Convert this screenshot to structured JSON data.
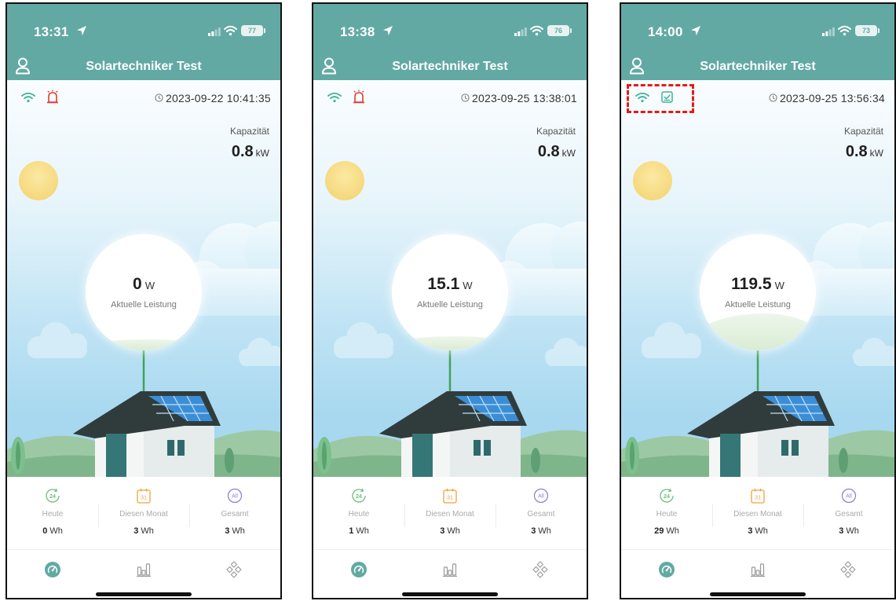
{
  "colors": {
    "accent": "#62a9a4",
    "alarm": "#e53935",
    "highlight": "#e21b1b"
  },
  "phones": [
    {
      "status_time": "13:31",
      "battery": "77",
      "app_title": "Solartechniker Test",
      "timestamp": "2023-09-22 10:41:35",
      "status_icon": "alarm-icon",
      "capacity_label": "Kapazität",
      "capacity_value": "0.8",
      "capacity_unit": "kW",
      "power_value": "0",
      "power_unit": "W",
      "power_label": "Aktuelle Leistung",
      "stats": [
        {
          "icon": "today-24h-icon",
          "icon_text": "24",
          "label": "Heute",
          "value": "0",
          "unit": "Wh"
        },
        {
          "icon": "calendar-icon",
          "icon_text": "31",
          "label": "Diesen Monat",
          "value": "3",
          "unit": "Wh"
        },
        {
          "icon": "all-icon",
          "icon_text": "All",
          "label": "Gesamt",
          "value": "3",
          "unit": "Wh"
        }
      ],
      "tabs": [
        "dashboard-icon",
        "bar-chart-icon",
        "device-grid-icon"
      ]
    },
    {
      "status_time": "13:38",
      "battery": "76",
      "app_title": "Solartechniker Test",
      "timestamp": "2023-09-25 13:38:01",
      "status_icon": "alarm-icon",
      "capacity_label": "Kapazität",
      "capacity_value": "0.8",
      "capacity_unit": "kW",
      "power_value": "15.1",
      "power_unit": "W",
      "power_label": "Aktuelle Leistung",
      "stats": [
        {
          "icon": "today-24h-icon",
          "icon_text": "24",
          "label": "Heute",
          "value": "1",
          "unit": "Wh"
        },
        {
          "icon": "calendar-icon",
          "icon_text": "31",
          "label": "Diesen Monat",
          "value": "3",
          "unit": "Wh"
        },
        {
          "icon": "all-icon",
          "icon_text": "All",
          "label": "Gesamt",
          "value": "3",
          "unit": "Wh"
        }
      ],
      "tabs": [
        "dashboard-icon",
        "bar-chart-icon",
        "device-grid-icon"
      ]
    },
    {
      "status_time": "14:00",
      "battery": "73",
      "app_title": "Solartechniker Test",
      "timestamp": "2023-09-25 13:56:34",
      "status_icon": "device-ok-icon",
      "capacity_label": "Kapazität",
      "capacity_value": "0.8",
      "capacity_unit": "kW",
      "power_value": "119.5",
      "power_unit": "W",
      "power_label": "Aktuelle Leistung",
      "stats": [
        {
          "icon": "today-24h-icon",
          "icon_text": "24",
          "label": "Heute",
          "value": "29",
          "unit": "Wh"
        },
        {
          "icon": "calendar-icon",
          "icon_text": "31",
          "label": "Diesen Monat",
          "value": "3",
          "unit": "Wh"
        },
        {
          "icon": "all-icon",
          "icon_text": "All",
          "label": "Gesamt",
          "value": "3",
          "unit": "Wh"
        }
      ],
      "tabs": [
        "dashboard-icon",
        "bar-chart-icon",
        "device-grid-icon"
      ]
    }
  ]
}
